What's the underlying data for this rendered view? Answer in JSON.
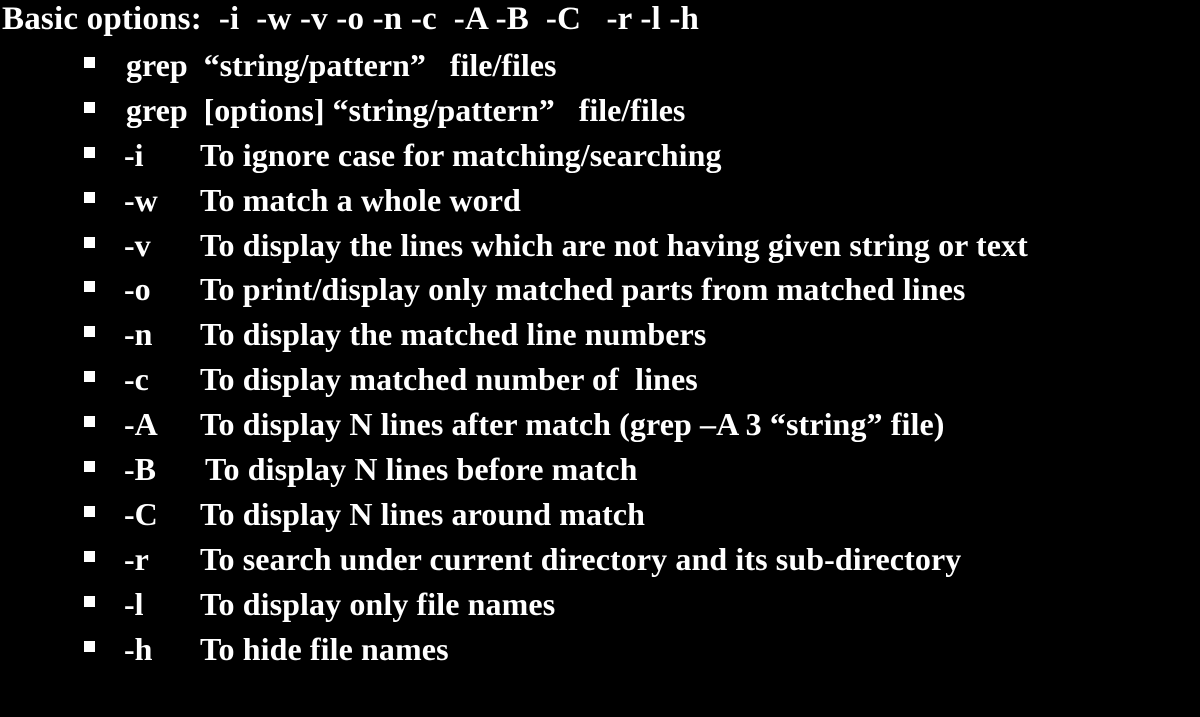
{
  "slide": {
    "heading": "Basic options:  -i  -w -v -o -n -c  -A -B  -C   -r -l -h",
    "syntax": [
      "grep  “string/pattern”   file/files",
      "grep  [options] “string/pattern”   file/files"
    ],
    "options": [
      {
        "flag": "-i",
        "description": "To ignore case for matching/searching"
      },
      {
        "flag": "-w",
        "description": "To match a whole word"
      },
      {
        "flag": "-v",
        "description": "To display the lines which are not having given string or text"
      },
      {
        "flag": "-o",
        "description": "To print/display only matched parts from matched lines"
      },
      {
        "flag": "-n",
        "description": "To display the matched line numbers"
      },
      {
        "flag": "-c",
        "description": "To display matched number of  lines"
      },
      {
        "flag": "-A",
        "description": "To display N lines after match (grep –A 3 “string” file)"
      },
      {
        "flag": "-B",
        "description": "To display N lines before match"
      },
      {
        "flag": "-C",
        "description": "To display N lines around match"
      },
      {
        "flag": "-r",
        "description": "To search under current directory and its sub-directory"
      },
      {
        "flag": "-l",
        "description": "To display only file names"
      },
      {
        "flag": "-h",
        "description": "To hide file names"
      }
    ],
    "colors": {
      "background": "#000000",
      "text": "#ffffff"
    }
  }
}
